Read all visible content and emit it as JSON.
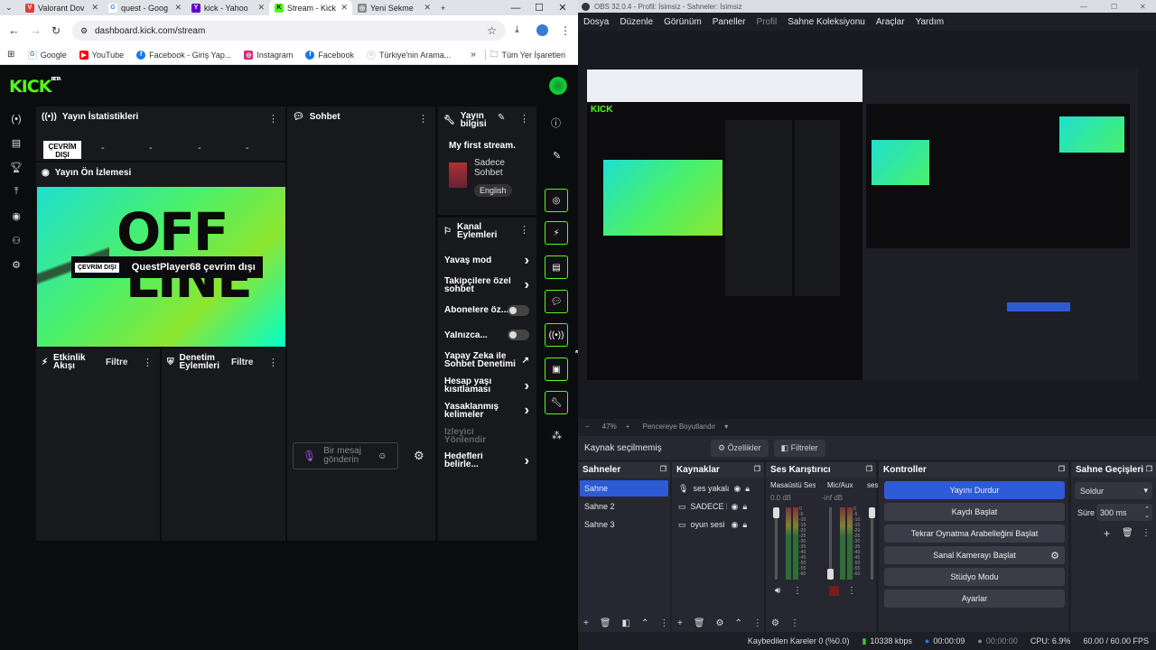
{
  "browser": {
    "tabs": [
      {
        "label": "Valorant Dov"
      },
      {
        "label": "quest - Goog"
      },
      {
        "label": "kick - Yahoo"
      },
      {
        "label": "Stream - Kick"
      },
      {
        "label": "Yeni Sekme"
      }
    ],
    "url": "dashboard.kick.com/stream",
    "bookmarks": [
      {
        "label": "Google"
      },
      {
        "label": "YouTube"
      },
      {
        "label": "Facebook - Giriş Yap..."
      },
      {
        "label": "Instagram"
      },
      {
        "label": "Facebook"
      },
      {
        "label": "Türkiye'nin Arama..."
      }
    ],
    "all_bookmarks": "Tüm Yer İşaretleri"
  },
  "kick": {
    "logo": "KICK",
    "logo_beta": "BETA",
    "brand_color": "#53fc18",
    "stats": {
      "title": "Yayın İstatistikleri",
      "offline": "ÇEVRİM DIŞI",
      "dashes": [
        "-",
        "-",
        "-",
        "-"
      ]
    },
    "preview": {
      "title": "Yayın Ön İzlemesi",
      "badge": "ÇEVRİM DIŞI",
      "text": "QuestPlayer68 çevrim dışı",
      "big1": "OFF",
      "big2": "LINE"
    },
    "chat": {
      "title": "Sohbet",
      "placeholder": "Bir mesaj gönderin"
    },
    "stream_info": {
      "title": "Yayın bilgisi",
      "stream_title": "My first stream.",
      "category": "Sadece Sohbet",
      "language": "English"
    },
    "channel_actions": {
      "title": "Kanal Eylemleri",
      "items": [
        {
          "label": "Yavaş mod",
          "type": "chevron"
        },
        {
          "label": "Takipçilere özel sohbet",
          "type": "chevron"
        },
        {
          "label": "Abonelere öz...",
          "type": "toggle"
        },
        {
          "label": "Yalnızca...",
          "type": "toggle"
        },
        {
          "label": "Yapay Zeka ile Sohbet Denetimi",
          "type": "external"
        },
        {
          "label": "Hesap yaşı kısıtlaması",
          "type": "chevron"
        },
        {
          "label": "Yasaklanmış kelimeler",
          "type": "chevron"
        },
        {
          "label": "İzleyici Yönlendir",
          "type": "disabled"
        },
        {
          "label": "Hedefleri belirle...",
          "type": "chevron"
        }
      ]
    },
    "activity": {
      "title": "Etkinlik Akışı",
      "filter": "Filtre"
    },
    "moderation": {
      "title": "Denetim Eylemleri",
      "filter": "Filtre"
    }
  },
  "obs": {
    "title": "OBS 32.0.4 - Profil: İsimsiz - Sahneler: İsimsiz",
    "menu": [
      "Dosya",
      "Düzenle",
      "Görünüm",
      "Paneller",
      "Profil",
      "Sahne Koleksiyonu",
      "Araçlar",
      "Yardım"
    ],
    "zoom": "47%",
    "fit": "Pencereye Boyutlandır",
    "no_source": "Kaynak seçilmemiş",
    "properties": "Özellikler",
    "filters": "Filtreler",
    "scenes": {
      "title": "Sahneler",
      "items": [
        "Sahne",
        "Sahne 2",
        "Sahne 3"
      ]
    },
    "sources": {
      "title": "Kaynaklar",
      "items": [
        "ses yakala",
        "SADECE M",
        "oyun sesi"
      ]
    },
    "mixer": {
      "title": "Ses Karıştırıcı",
      "ch1": "Masaüstü Ses",
      "ch1_db": "0.0 dB",
      "ch2": "Mic/Aux",
      "ch2_db": "-inf dB",
      "ch3": "ses",
      "scale": [
        "0",
        "-5",
        "-10",
        "-15",
        "-20",
        "-25",
        "-30",
        "-35",
        "-40",
        "-45",
        "-50",
        "-55",
        "-60"
      ]
    },
    "controls": {
      "title": "Kontroller",
      "buttons": [
        "Yayını Durdur",
        "Kaydı Başlat",
        "Tekrar Oynatma Arabelleğini Başlat",
        "Sanal Kamerayı Başlat",
        "Stüdyo Modu",
        "Ayarlar"
      ]
    },
    "transitions": {
      "title": "Sahne Geçişleri",
      "selected": "Soldur",
      "duration_label": "Süre",
      "duration": "300 ms"
    },
    "status": {
      "dropped": "Kaybedilen Kareler 0 (%0.0)",
      "bitrate": "10338 kbps",
      "live_time": "00:00:09",
      "rec_time": "00:00:00",
      "cpu": "CPU: 6.9%",
      "fps": "60.00 / 60.00 FPS"
    }
  }
}
